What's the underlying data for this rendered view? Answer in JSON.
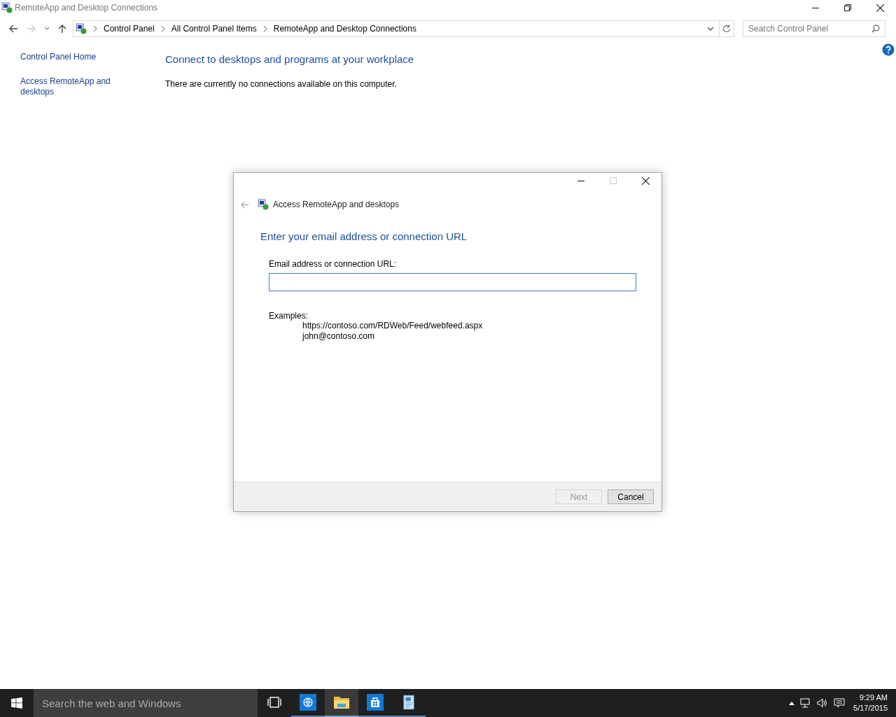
{
  "window": {
    "title": "RemoteApp and Desktop Connections"
  },
  "nav": [
    {
      "kind": "back",
      "disabled": false
    },
    {
      "kind": "forward",
      "disabled": true
    },
    {
      "kind": "recent",
      "disabled": false
    },
    {
      "kind": "up",
      "disabled": false
    }
  ],
  "breadcrumb": [
    "Control Panel",
    "All Control Panel Items",
    "RemoteApp and Desktop Connections"
  ],
  "search": {
    "placeholder": "Search Control Panel"
  },
  "sidebar": {
    "items": [
      "Control Panel Home",
      "Access RemoteApp and desktops"
    ]
  },
  "main": {
    "heading": "Connect to desktops and programs at your workplace",
    "message": "There are currently no connections available on this computer."
  },
  "dialog": {
    "title": "Access RemoteApp and desktops",
    "back_disabled": true,
    "maximize_disabled": true,
    "heading": "Enter your email address or connection URL",
    "field_label": "Email address or connection URL:",
    "examples_label": "Examples:",
    "examples": [
      "https://contoso.com/RDWeb/Feed/webfeed.aspx",
      "john@contoso.com"
    ],
    "buttons": [
      {
        "label": "Next",
        "disabled": true
      },
      {
        "label": "Cancel",
        "disabled": false
      }
    ]
  },
  "taskbar": {
    "search_placeholder": "Search the web and Windows",
    "apps": [
      {
        "kind": "globe",
        "selected": false
      },
      {
        "kind": "folder",
        "selected": true
      },
      {
        "kind": "store",
        "selected": false
      },
      {
        "kind": "remote",
        "selected": false
      }
    ],
    "time": "9:29 AM",
    "date": "5/17/2015"
  }
}
